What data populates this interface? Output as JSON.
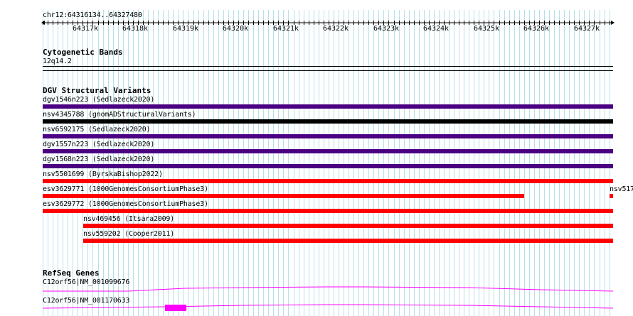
{
  "ruler": {
    "location": "chr12:64316134..64327480",
    "ticks": [
      "64317k",
      "64318k",
      "64319k",
      "64320k",
      "64321k",
      "64322k",
      "64323k",
      "64324k",
      "64325k",
      "64326k",
      "64327k"
    ]
  },
  "tracks": {
    "cyto": {
      "title": "Cytogenetic Bands",
      "band": "12q14.2"
    },
    "dgv": {
      "title": "DGV Structural Variants",
      "features": [
        {
          "label": "dgv1546n223 (Sedlazeck2020)",
          "color": "#4b0082"
        },
        {
          "label": "nsv4345788 (gnomADStructuralVariants)",
          "color": "#000000"
        },
        {
          "label": "nsv6592175 (Sedlazeck2020)",
          "color": "#4b0082"
        },
        {
          "label": "dgv1557n223 (Sedlazeck2020)",
          "color": "#4b0082"
        },
        {
          "label": "dgv1568n223 (Sedlazeck2020)",
          "color": "#4b0082"
        },
        {
          "label": "nsv5501699 (ByrskaBishop2022)",
          "color": "#ff0000"
        },
        {
          "label": "esv3629771 (1000GenomesConsortiumPhase3)",
          "color": "#ff0000"
        },
        {
          "label": "nsv517",
          "color": "#ff0000"
        },
        {
          "label": "esv3629772 (1000GenomesConsortiumPhase3)",
          "color": "#ff0000"
        },
        {
          "label": "nsv469456 (Itsara2009)",
          "color": "#ff0000"
        },
        {
          "label": "nsv559202 (Cooper2011)",
          "color": "#ff0000"
        }
      ]
    },
    "refseq": {
      "title": "RefSeq Genes",
      "genes": [
        {
          "label": "C12orf56|NM_001099676",
          "color": "#ff00ff"
        },
        {
          "label": "C12orf56|NM_001170633",
          "color": "#ff00ff"
        }
      ]
    }
  }
}
